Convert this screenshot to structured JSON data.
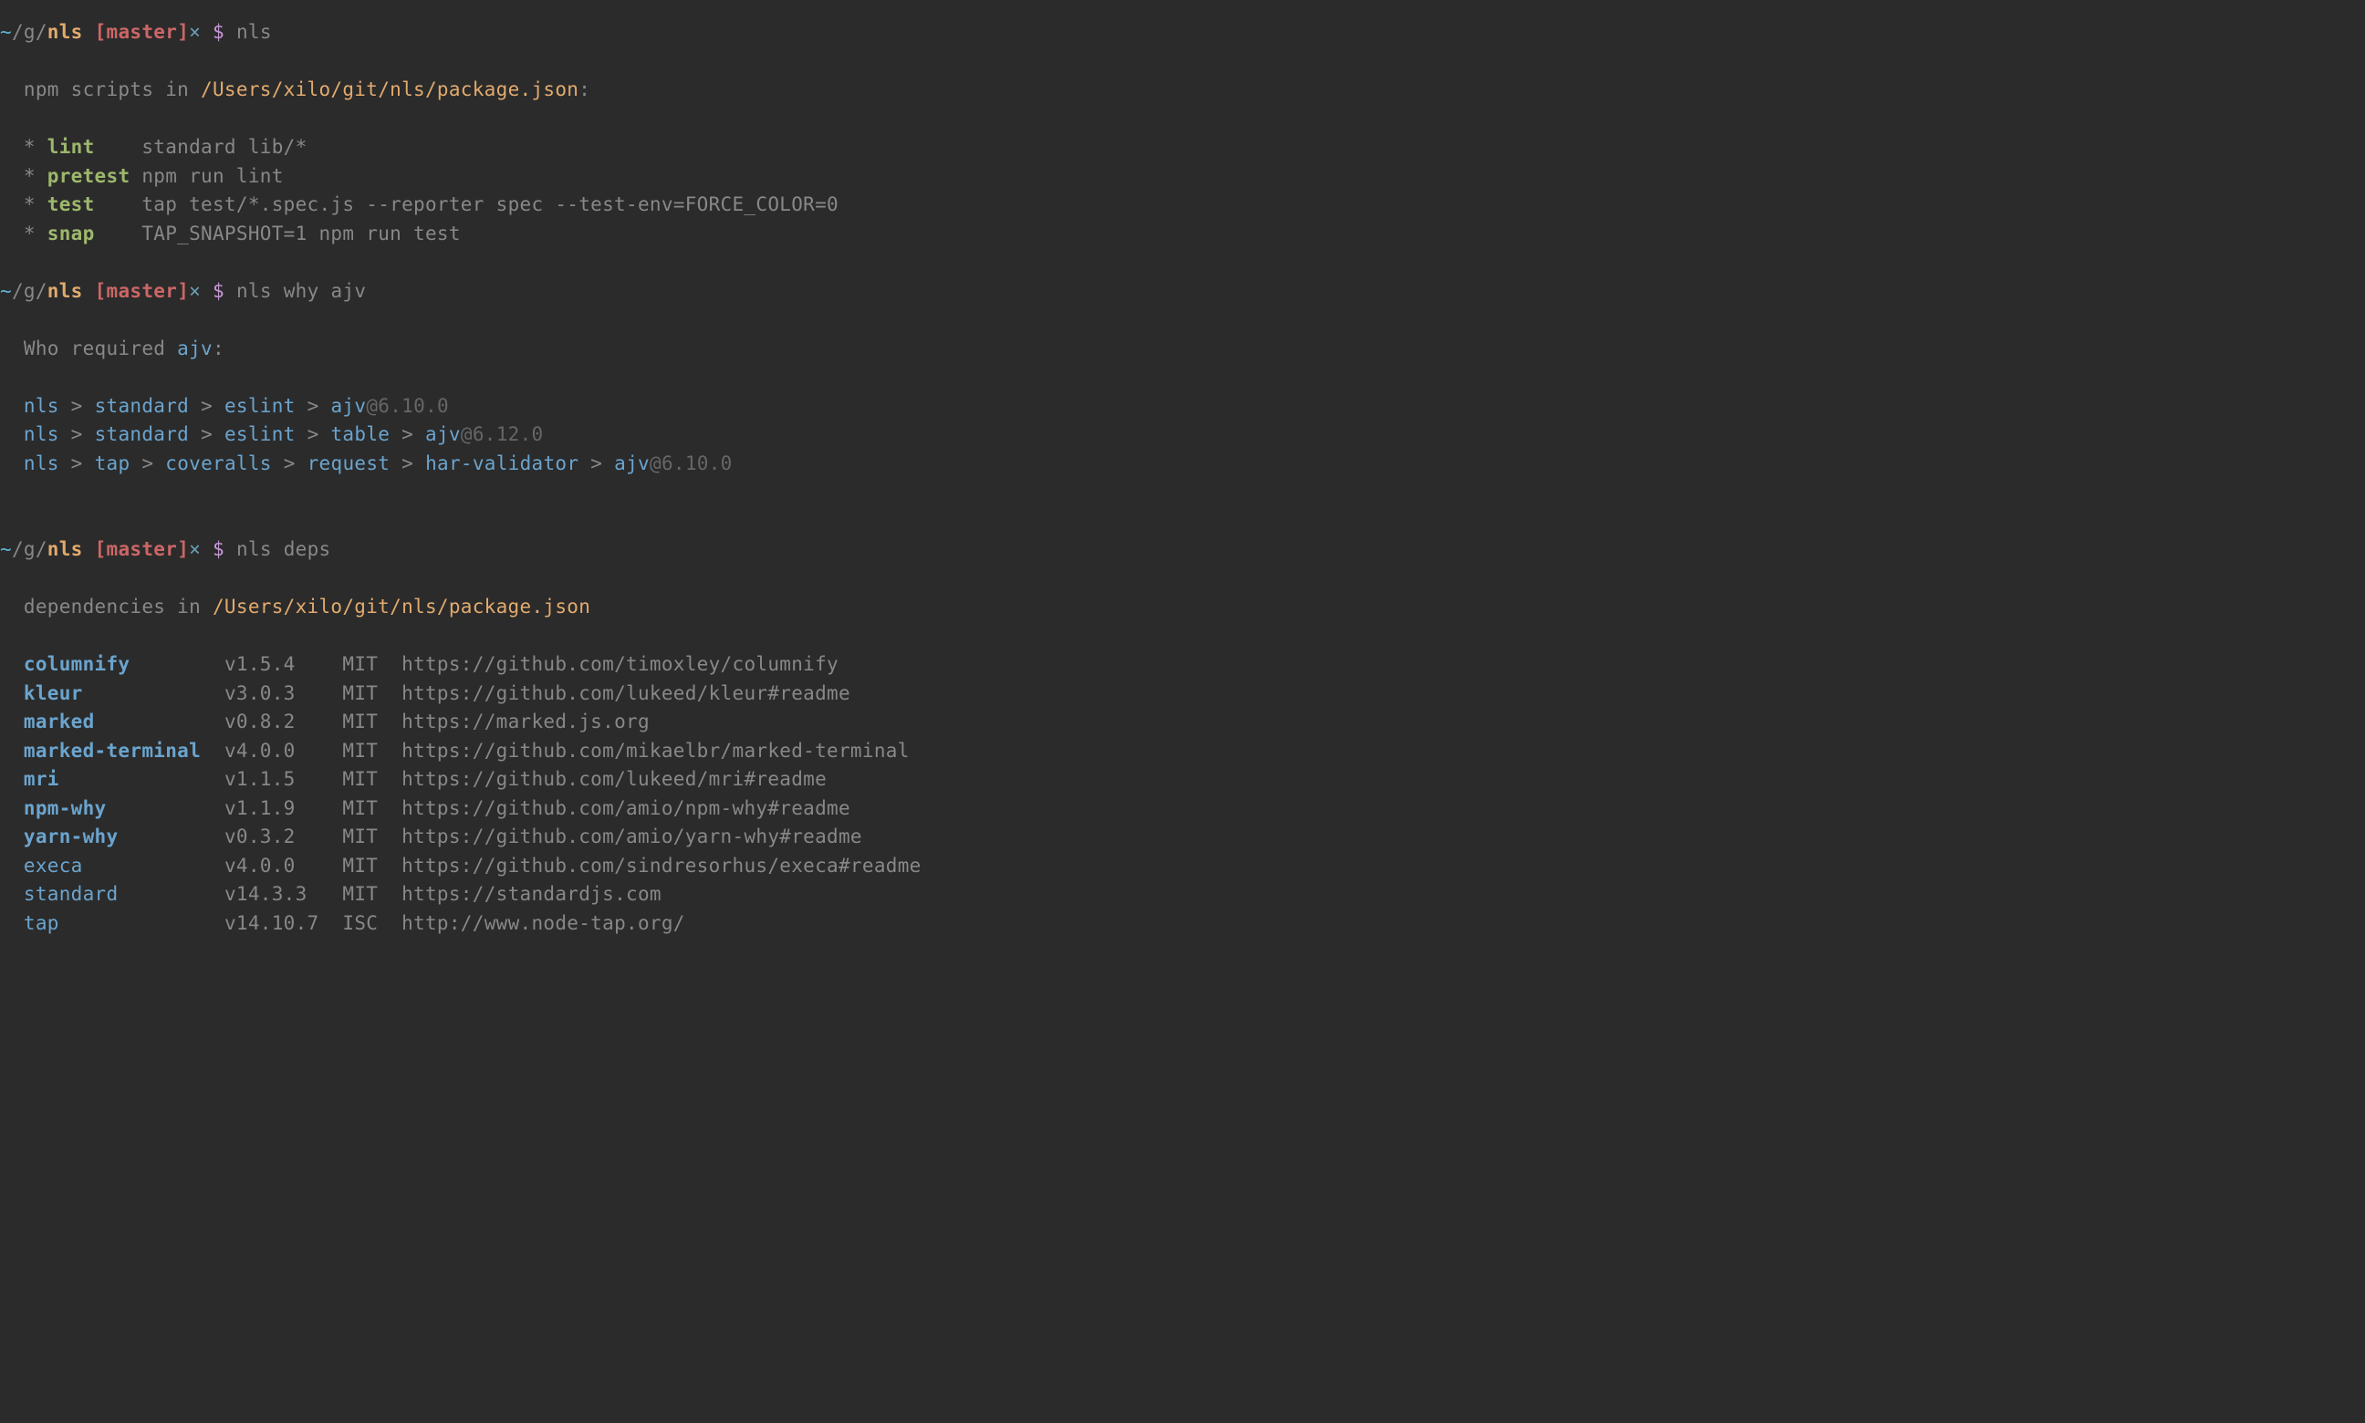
{
  "prompt": {
    "tilde": "~",
    "path": "/g/",
    "dir": "nls",
    "branch_open": " [",
    "branch": "master",
    "branch_close": "]",
    "x": "×",
    "dollar": " $ "
  },
  "cmd1": "nls",
  "scripts_header_prefix": "npm scripts in ",
  "scripts_header_path": "/Users/xilo/git/nls/package.json",
  "scripts_header_suffix": ":",
  "scripts": [
    {
      "name": "lint",
      "cmd": "standard lib/*"
    },
    {
      "name": "pretest",
      "cmd": "npm run lint"
    },
    {
      "name": "test",
      "cmd": "tap test/*.spec.js --reporter spec --test-env=FORCE_COLOR=0"
    },
    {
      "name": "snap",
      "cmd": "TAP_SNAPSHOT=1 npm run test"
    }
  ],
  "script_name_width": 7,
  "cmd2": "nls why ajv",
  "who_prefix": "Who required ",
  "who_pkg": "ajv",
  "who_suffix": ":",
  "chains": [
    {
      "parts": [
        "nls",
        "standard",
        "eslint",
        "ajv"
      ],
      "ver": "@6.10.0"
    },
    {
      "parts": [
        "nls",
        "standard",
        "eslint",
        "table",
        "ajv"
      ],
      "ver": "@6.12.0"
    },
    {
      "parts": [
        "nls",
        "tap",
        "coveralls",
        "request",
        "har-validator",
        "ajv"
      ],
      "ver": "@6.10.0"
    }
  ],
  "chain_sep": " > ",
  "cmd3": "nls deps",
  "deps_header_prefix": "dependencies in ",
  "deps_header_path": "/Users/xilo/git/nls/package.json",
  "deps": [
    {
      "name": "columnify",
      "bold": true,
      "ver": "v1.5.4",
      "lic": "MIT",
      "url": "https://github.com/timoxley/columnify"
    },
    {
      "name": "kleur",
      "bold": true,
      "ver": "v3.0.3",
      "lic": "MIT",
      "url": "https://github.com/lukeed/kleur#readme"
    },
    {
      "name": "marked",
      "bold": true,
      "ver": "v0.8.2",
      "lic": "MIT",
      "url": "https://marked.js.org"
    },
    {
      "name": "marked-terminal",
      "bold": true,
      "ver": "v4.0.0",
      "lic": "MIT",
      "url": "https://github.com/mikaelbr/marked-terminal"
    },
    {
      "name": "mri",
      "bold": true,
      "ver": "v1.1.5",
      "lic": "MIT",
      "url": "https://github.com/lukeed/mri#readme"
    },
    {
      "name": "npm-why",
      "bold": true,
      "ver": "v1.1.9",
      "lic": "MIT",
      "url": "https://github.com/amio/npm-why#readme"
    },
    {
      "name": "yarn-why",
      "bold": true,
      "ver": "v0.3.2",
      "lic": "MIT",
      "url": "https://github.com/amio/yarn-why#readme"
    },
    {
      "name": "execa",
      "bold": false,
      "ver": "v4.0.0",
      "lic": "MIT",
      "url": "https://github.com/sindresorhus/execa#readme"
    },
    {
      "name": "standard",
      "bold": false,
      "ver": "v14.3.3",
      "lic": "MIT",
      "url": "https://standardjs.com"
    },
    {
      "name": "tap",
      "bold": false,
      "ver": "v14.10.7",
      "lic": "ISC",
      "url": "http://www.node-tap.org/"
    }
  ],
  "dep_cols": {
    "name": 17,
    "ver": 10,
    "lic": 5
  },
  "bullet": "*"
}
